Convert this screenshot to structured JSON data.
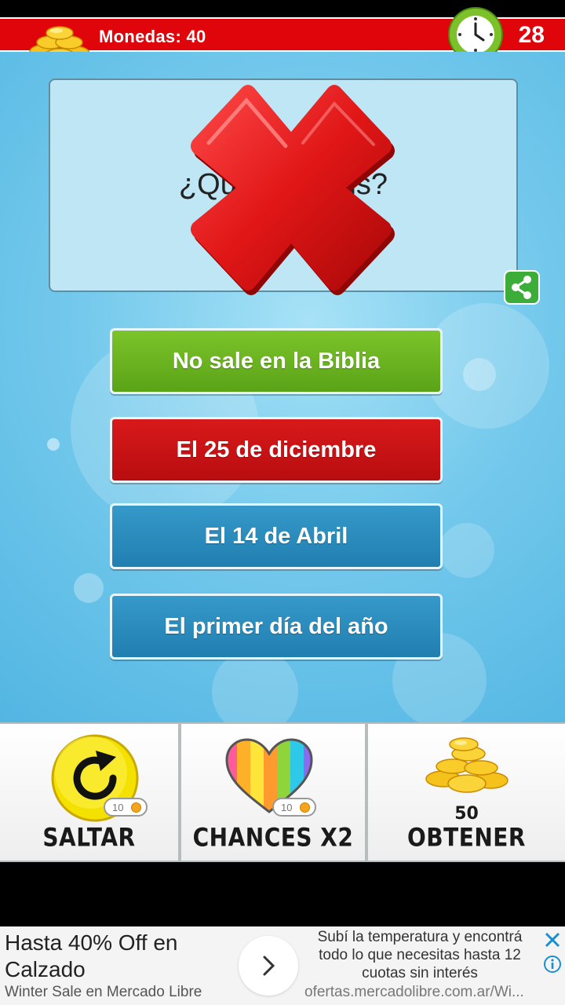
{
  "top_bar": {
    "coins_label": "Monedas: 40",
    "timer": "28"
  },
  "question": {
    "text": "¿Qué di          Jesús?"
  },
  "answers": [
    {
      "label": "No sale en la Biblia",
      "state": "correct",
      "color": "#6cb820"
    },
    {
      "label": "El 25 de diciembre",
      "state": "wrong",
      "color": "#cc1214"
    },
    {
      "label": "El 14 de Abril",
      "state": "neutral",
      "color": "#2a8cbd"
    },
    {
      "label": "El primer día del año",
      "state": "neutral",
      "color": "#2a8cbd"
    }
  ],
  "powerups": {
    "skip": {
      "label": "SALTAR",
      "cost": "10",
      "icon": "skip-refresh-icon"
    },
    "chances": {
      "label": "CHANCES X2",
      "cost": "10",
      "icon": "rainbow-heart-icon"
    },
    "get": {
      "amount": "50",
      "label": "OBTENER",
      "icon": "coin-stack-icon"
    }
  },
  "ad": {
    "headline": "Hasta 40% Off en Calzado",
    "subline": "Winter Sale en Mercado Libre",
    "body": "Subí la temperatura y encontrá todo lo que necesitas hasta 12 cuotas sin interés",
    "url": "ofertas.mercadolibre.com.ar/Wi..."
  },
  "colors": {
    "top_bar": "#e0050b",
    "background": "#74c9ec",
    "correct": "#6cb820",
    "wrong": "#cc1214",
    "neutral": "#2a8cbd"
  }
}
